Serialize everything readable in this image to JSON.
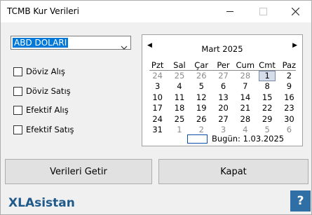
{
  "window": {
    "title": "TCMB Kur Verileri"
  },
  "currency": {
    "selected": "ABD DOLARI"
  },
  "checkboxes": [
    {
      "label": "Döviz Alış",
      "checked": false
    },
    {
      "label": "Döviz Satış",
      "checked": false
    },
    {
      "label": "Efektif Alış",
      "checked": false
    },
    {
      "label": "Efektif Satış",
      "checked": false
    }
  ],
  "calendar": {
    "month": "Mart 2025",
    "weekdays": [
      "Pzt",
      "Sal",
      "Çar",
      "Per",
      "Cum",
      "Cmt",
      "Paz"
    ],
    "days": [
      [
        "24",
        "25",
        "26",
        "27",
        "28",
        "1",
        "2"
      ],
      [
        "3",
        "4",
        "5",
        "6",
        "7",
        "8",
        "9"
      ],
      [
        "10",
        "11",
        "12",
        "13",
        "14",
        "15",
        "16"
      ],
      [
        "17",
        "18",
        "19",
        "20",
        "21",
        "22",
        "23"
      ],
      [
        "24",
        "25",
        "26",
        "27",
        "28",
        "29",
        "30"
      ],
      [
        "31",
        "1",
        "2",
        "3",
        "4",
        "5",
        "6"
      ]
    ],
    "other_month_cells": [
      [
        0,
        0
      ],
      [
        0,
        1
      ],
      [
        0,
        2
      ],
      [
        0,
        3
      ],
      [
        0,
        4
      ],
      [
        5,
        1
      ],
      [
        5,
        2
      ],
      [
        5,
        3
      ],
      [
        5,
        4
      ],
      [
        5,
        5
      ],
      [
        5,
        6
      ]
    ],
    "selected_cell": [
      0,
      5
    ],
    "today_label": "Bugün: 1.03.2025"
  },
  "buttons": {
    "get_data": "Verileri Getir",
    "close": "Kapat"
  },
  "footer": {
    "brand": "XLAsistan",
    "help": "?"
  },
  "colors": {
    "selection": "#0078d7",
    "brand": "#1f5a8a",
    "help_bg": "#2f6fa5"
  }
}
